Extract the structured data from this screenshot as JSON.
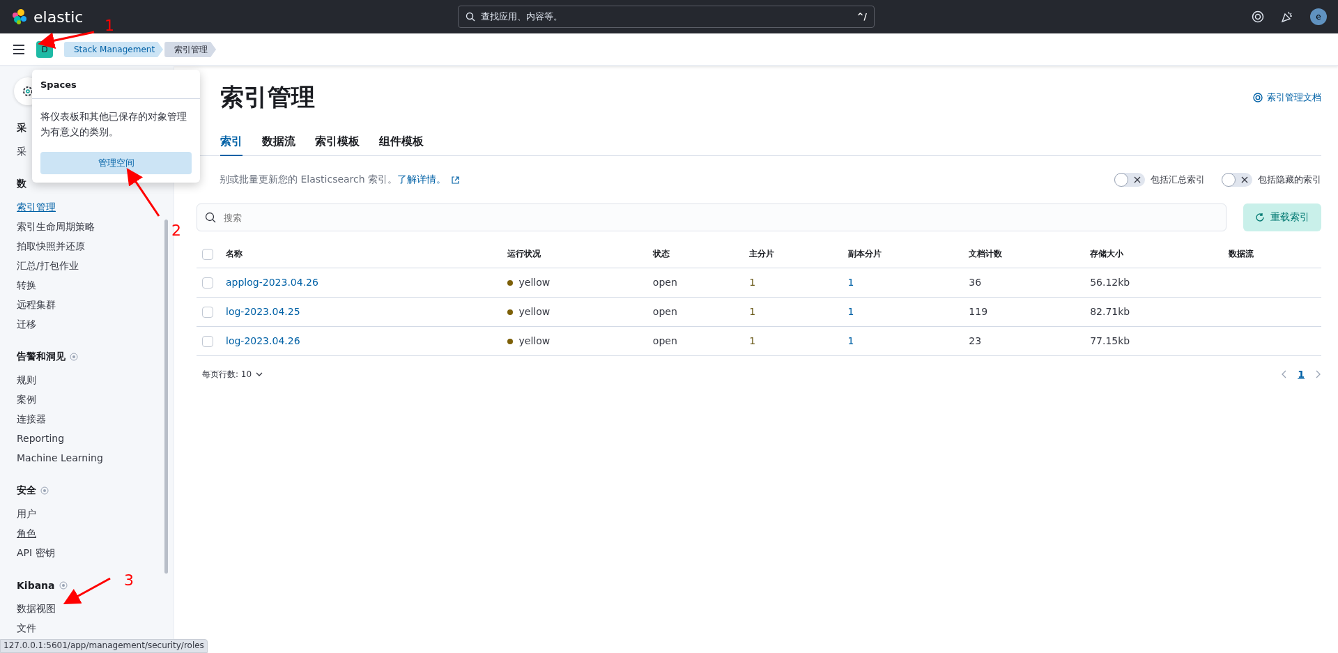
{
  "top_bar": {
    "brand": "elastic",
    "search_placeholder": "查找应用、内容等。",
    "shortcut": "^/",
    "avatar": "e"
  },
  "breadcrumb_bar": {
    "space": "D",
    "crumbs": [
      {
        "label": "Stack Management",
        "selected": false
      },
      {
        "label": "索引管理",
        "selected": true
      }
    ]
  },
  "spaces_popover": {
    "title": "Spaces",
    "text": "将仪表板和其他已保存的对象管理为有意义的类别。",
    "button": "管理空间"
  },
  "sidebar": {
    "sections": [
      {
        "title": "采",
        "help": false,
        "items": [
          {
            "label": "采",
            "selected": false,
            "hovered": false
          }
        ]
      },
      {
        "title": "数",
        "help": false,
        "items": [
          {
            "label": "索引管理",
            "selected": true,
            "hovered": false
          },
          {
            "label": "索引生命周期策略",
            "selected": false,
            "hovered": false
          },
          {
            "label": "拍取快照并还原",
            "selected": false,
            "hovered": false
          },
          {
            "label": "汇总/打包作业",
            "selected": false,
            "hovered": false
          },
          {
            "label": "转换",
            "selected": false,
            "hovered": false
          },
          {
            "label": "远程集群",
            "selected": false,
            "hovered": false
          },
          {
            "label": "迁移",
            "selected": false,
            "hovered": false
          }
        ]
      },
      {
        "title": "告警和洞见",
        "help": true,
        "items": [
          {
            "label": "规则",
            "selected": false,
            "hovered": false
          },
          {
            "label": "案例",
            "selected": false,
            "hovered": false
          },
          {
            "label": "连接器",
            "selected": false,
            "hovered": false
          },
          {
            "label": "Reporting",
            "selected": false,
            "hovered": false
          },
          {
            "label": "Machine Learning",
            "selected": false,
            "hovered": false
          }
        ]
      },
      {
        "title": "安全",
        "help": true,
        "items": [
          {
            "label": "用户",
            "selected": false,
            "hovered": false
          },
          {
            "label": "角色",
            "selected": false,
            "hovered": true
          },
          {
            "label": "API 密钥",
            "selected": false,
            "hovered": false
          }
        ]
      },
      {
        "title": "Kibana",
        "help": true,
        "items": [
          {
            "label": "数据视图",
            "selected": false,
            "hovered": false
          },
          {
            "label": "文件",
            "selected": false,
            "hovered": false
          }
        ]
      }
    ]
  },
  "page": {
    "title": "索引管理",
    "docs_link": "索引管理文档",
    "tabs": [
      {
        "label": "索引",
        "selected": true
      },
      {
        "label": "数据流",
        "selected": false
      },
      {
        "label": "索引模板",
        "selected": false
      },
      {
        "label": "组件模板",
        "selected": false
      }
    ],
    "description": "别或批量更新您的 Elasticsearch 索引。",
    "learn_more": "了解详情。",
    "switches": [
      {
        "label": "包括汇总索引",
        "on": false
      },
      {
        "label": "包括隐藏的索引",
        "on": false
      }
    ],
    "search_placeholder": "搜索",
    "reload_button": "重载索引"
  },
  "table": {
    "select_all_checked": false,
    "columns": [
      "名称",
      "运行状况",
      "状态",
      "主分片",
      "副本分片",
      "文档计数",
      "存储大小",
      "数据流"
    ],
    "rows": [
      {
        "checked": false,
        "color": "#7d6008",
        "cells": [
          "applog-2023.04.26",
          "yellow",
          "open",
          "1",
          "1",
          "36",
          "56.12kb"
        ]
      },
      {
        "checked": false,
        "color": "#7d6008",
        "cells": [
          "log-2023.04.25",
          "yellow",
          "open",
          "1",
          "1",
          "119",
          "82.71kb"
        ]
      },
      {
        "checked": false,
        "color": "#7d6008",
        "cells": [
          "log-2023.04.26",
          "yellow",
          "open",
          "1",
          "1",
          "23",
          "77.15kb"
        ]
      }
    ]
  },
  "pagination": {
    "rows_per_page": "每页行数: 10",
    "pages": [
      {
        "label": "1",
        "selected": true
      }
    ]
  },
  "status_url": "127.0.0.1:5601/app/management/security/roles",
  "annotations": [
    {
      "label": "1"
    },
    {
      "label": "2"
    },
    {
      "label": "3"
    }
  ]
}
